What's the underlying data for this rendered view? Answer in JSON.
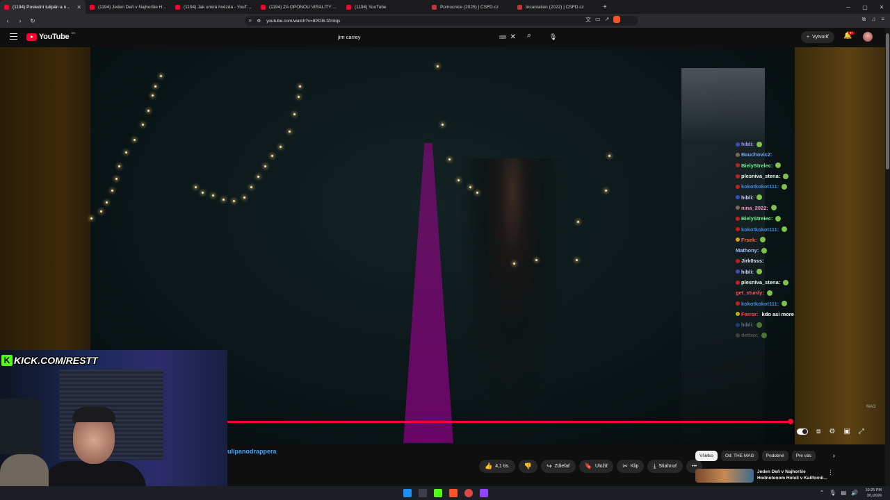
{
  "browser": {
    "tabs": [
      {
        "title": "(1194) Poslední tulipán a nešť...",
        "icon": "youtube-icon",
        "active": true
      },
      {
        "title": "(1194) Jeden Deň v Najhoršie Hodno...",
        "icon": "youtube-icon"
      },
      {
        "title": "(1194) Jak umirá hvězda - YouTube",
        "icon": "youtube-icon"
      },
      {
        "title": "(1194) ZA OPONOU VIRALITY: MEL...",
        "icon": "youtube-icon"
      },
      {
        "title": "(1194) YouTube",
        "icon": "youtube-icon"
      },
      {
        "title": "Pomocnice (2025) | ČSFD.cz",
        "icon": "csfd-icon"
      },
      {
        "title": "Incantation (2022) | ČSFD.cz",
        "icon": "csfd-icon"
      }
    ],
    "new_tab": "+",
    "url": "youtube.com/watch?v=8PGB-fZmtqs"
  },
  "youtube": {
    "logo_text": "YouTube",
    "logo_region": "SK",
    "search_value": "jim carrey",
    "create_label": "Vytvoriť",
    "notif_count": "9+"
  },
  "chat": [
    {
      "user": "hibli:",
      "color": "#9aa0ff",
      "badge": "#3050c0",
      "emote": true
    },
    {
      "user": "Bauchovic2:",
      "color": "#6aa7ff",
      "badge": "#7a6a5a",
      "emote": false
    },
    {
      "user": "BielyStrelec:",
      "color": "#6cf28a",
      "badge": "#c02020",
      "emote": true
    },
    {
      "user": "plesniva_stena:",
      "color": "#e8fff0",
      "badge": "#c02020",
      "emote": true
    },
    {
      "user": "kokotkokot111:",
      "color": "#3f8fe0",
      "badge": "#c02020",
      "emote": true
    },
    {
      "user": "hibli:",
      "color": "#cfd2ff",
      "badge": "#3050c0",
      "emote": true
    },
    {
      "user": "nina_2022:",
      "color": "#ff8fbf",
      "badge": "#7a6a5a",
      "emote": true
    },
    {
      "user": "BielyStrelec:",
      "color": "#6cf28a",
      "badge": "#c02020",
      "emote": true
    },
    {
      "user": "kokotkokot111:",
      "color": "#3f8fe0",
      "badge": "#c02020",
      "emote": true
    },
    {
      "user": "Frsek:",
      "color": "#ff6a3a",
      "badge": "#d4a020",
      "emote": true
    },
    {
      "user": "Mathony:",
      "color": "#9ec1ff",
      "badge": "",
      "emote": true
    },
    {
      "user": "Jirk0sss:",
      "color": "#e8e8ff",
      "badge": "#c02020",
      "emote": false
    },
    {
      "user": "hibli:",
      "color": "#cfd2ff",
      "badge": "#3050c0",
      "emote": true
    },
    {
      "user": "plesniva_stena:",
      "color": "#e8fff0",
      "badge": "#c02020",
      "emote": true
    },
    {
      "user": "get_sturdy:",
      "color": "#ff5a5a",
      "badge": "",
      "emote": true
    },
    {
      "user": "kokotkokot111:",
      "color": "#3f8fe0",
      "badge": "#c02020",
      "emote": true
    },
    {
      "user": "Ferror:",
      "color": "#ff5050",
      "badge": "#d4a020",
      "emote": false,
      "message": "kdo asi more"
    },
    {
      "user": "hibli:",
      "color": "#b0b3dd",
      "badge": "#3050c0",
      "emote": true
    },
    {
      "user": "dettox:",
      "color": "#8a8f8a",
      "badge": "#5a6a4a",
      "emote": true
    }
  ],
  "video": {
    "watermark": "MAG",
    "progress_fraction": 0.995
  },
  "overlay": {
    "kick_url": "KICK.COM/RESTT"
  },
  "below": {
    "channel_partial": "ulipanodrappera",
    "likes": "4,1 tis.",
    "share": "Zdieľať",
    "save": "Uložiť",
    "clip": "Klip",
    "download": "Stiahnuť",
    "more": "•••"
  },
  "chips": [
    "Všetko",
    "Od: THE MAG",
    "Podobné",
    "Pre vás"
  ],
  "related": {
    "title": "Jeden Deň v Najhoršie Hodnotenom Hoteli v Kalifornii..."
  },
  "clock": {
    "time": "10:25 PM",
    "date": "3/1/2026"
  },
  "colors": {
    "youtube_red": "#ff0033",
    "kick_green": "#53fc18",
    "link_blue": "#3ea6ff"
  }
}
